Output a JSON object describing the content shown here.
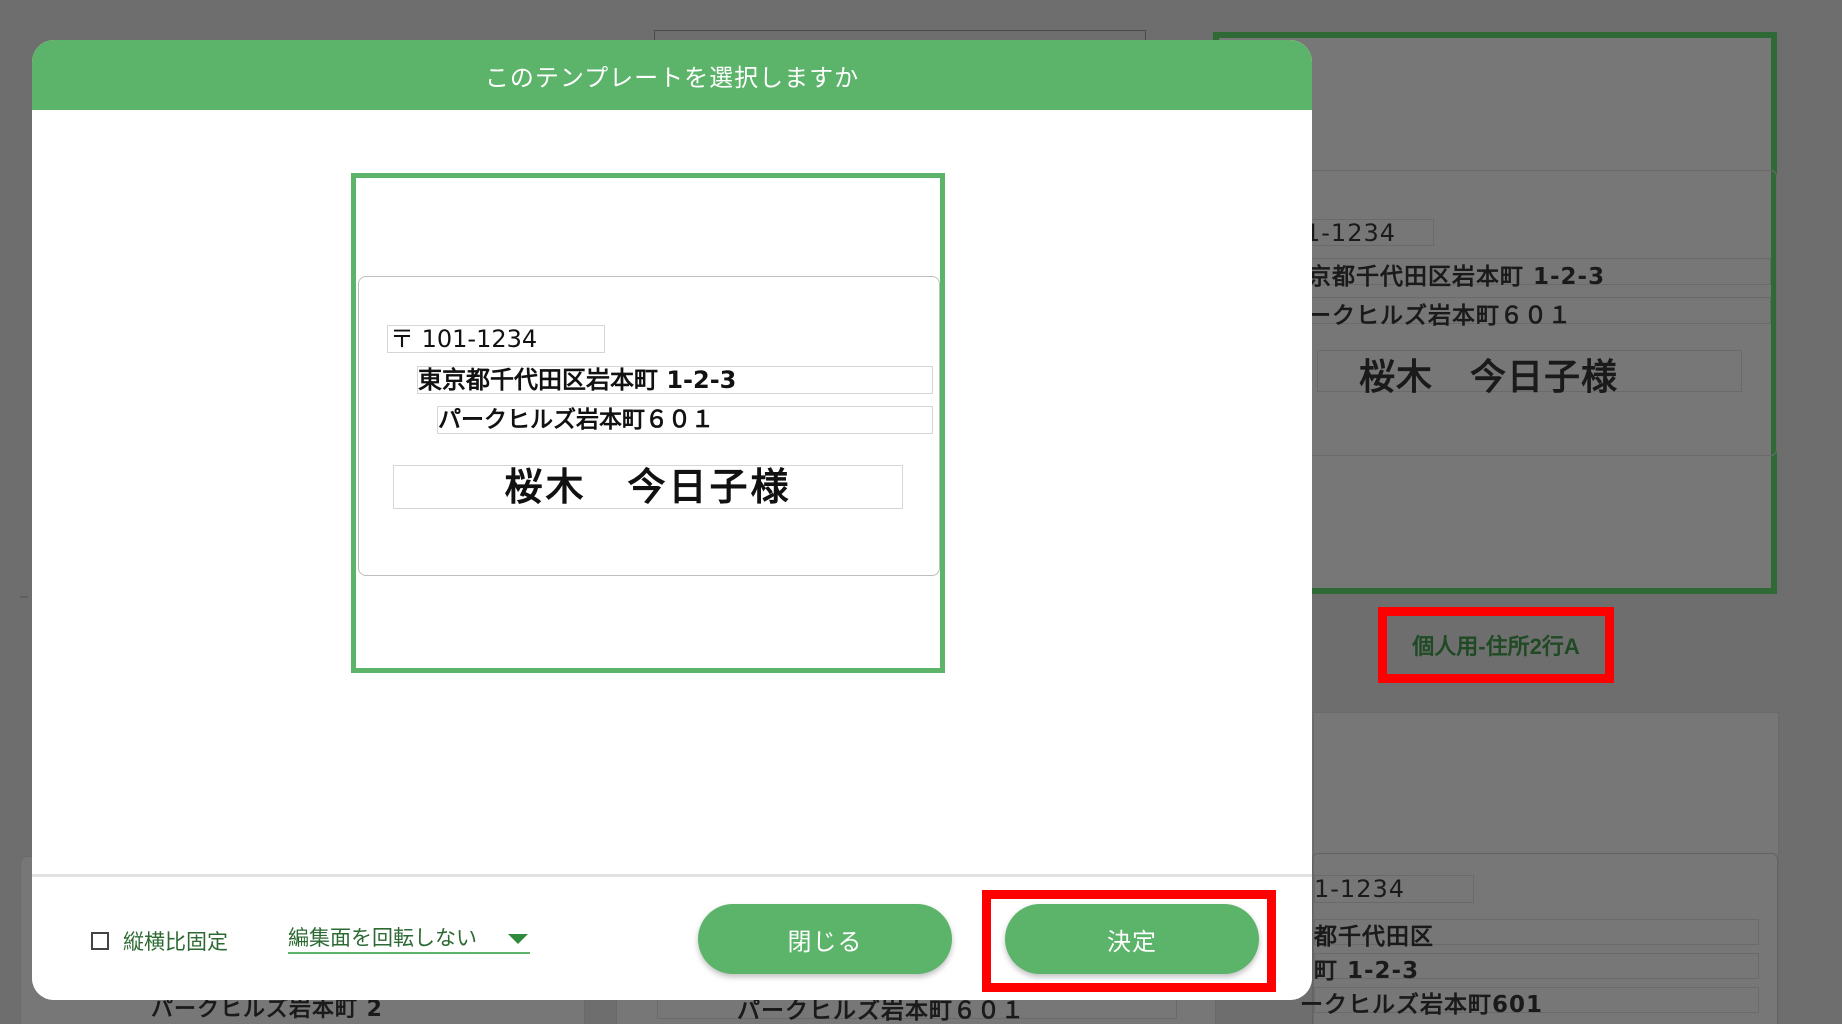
{
  "background": {
    "top_right": {
      "postal": "1-1234",
      "address1": "京都千代田区岩本町 1-2-3",
      "address2": "ークヒルズ岩本町６０１",
      "name": "桜木　今日子様"
    },
    "caption": "個人用-住所2行A",
    "bottom_right": {
      "postal": "1-1234",
      "address1": "都千代田区",
      "address2": "町 1-2-3",
      "address3": "ークヒルズ岩本町601"
    },
    "bottom_middle_text": "パークヒルズ岩本町６０１",
    "bottom_left_text": "パークヒルズ岩本町 2"
  },
  "modal": {
    "title": "このテンプレートを選択しますか",
    "preview": {
      "postal": "〒 101-1234",
      "address1": "東京都千代田区岩本町 1-2-3",
      "address2": "パークヒルズ岩本町６０１",
      "name": "桜木　今日子様"
    },
    "footer": {
      "aspect_label": "縦横比固定",
      "rotate_option": "編集面を回転しない",
      "close_label": "閉じる",
      "ok_label": "決定"
    }
  },
  "colors": {
    "accent": "#5cb36a",
    "dark_green": "#2d6a33",
    "highlight": "#ff0000",
    "overlay": "#6e6e6e"
  }
}
